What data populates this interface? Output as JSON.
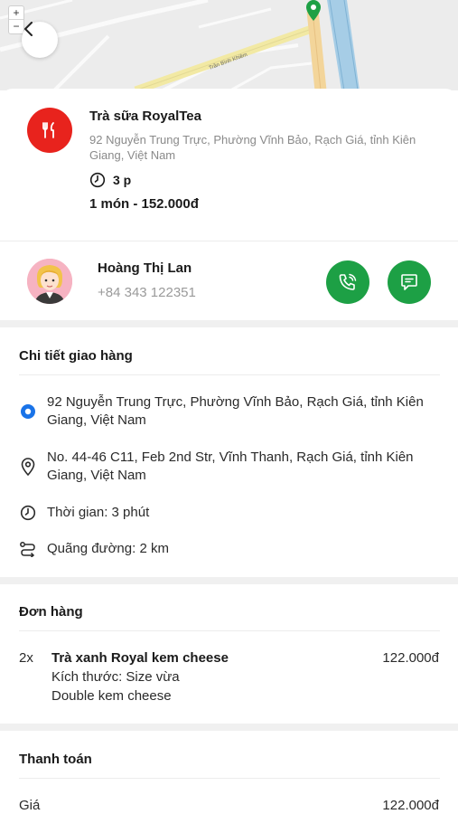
{
  "map": {
    "zoom_in": "+",
    "zoom_out": "−",
    "road_label": "Trần Bình Khiêm"
  },
  "store": {
    "name": "Trà sữa RoyalTea",
    "address": "92 Nguyễn Trung Trực, Phường Vĩnh Bảo, Rạch Giá, tỉnh Kiên Giang, Việt Nam",
    "eta": "3 p",
    "summary": "1 món - 152.000đ",
    "logo_color": "#e8231d"
  },
  "driver": {
    "name": "Hoàng Thị Lan",
    "phone": "+84 343 122351",
    "action_color": "#1da045"
  },
  "delivery": {
    "title": "Chi tiết giao hàng",
    "pickup": "92 Nguyễn Trung Trực, Phường Vĩnh Bảo, Rạch Giá, tỉnh Kiên Giang, Việt Nam",
    "dropoff": "No. 44-46 C11, Feb 2nd Str, Vĩnh Thanh, Rạch Giá, tỉnh Kiên Giang, Việt Nam",
    "time": "Thời gian: 3 phút",
    "distance": "Quãng đường: 2 km",
    "pickup_color": "#1a73e8"
  },
  "order": {
    "title": "Đơn hàng",
    "items": [
      {
        "qty": "2x",
        "name": "Trà xanh Royal kem cheese",
        "options": [
          "Kích thước: Size vừa",
          "Double kem cheese"
        ],
        "price": "122.000đ"
      }
    ]
  },
  "payment": {
    "title": "Thanh toán",
    "rows": [
      {
        "label": "Giá",
        "value": "122.000đ"
      }
    ]
  }
}
